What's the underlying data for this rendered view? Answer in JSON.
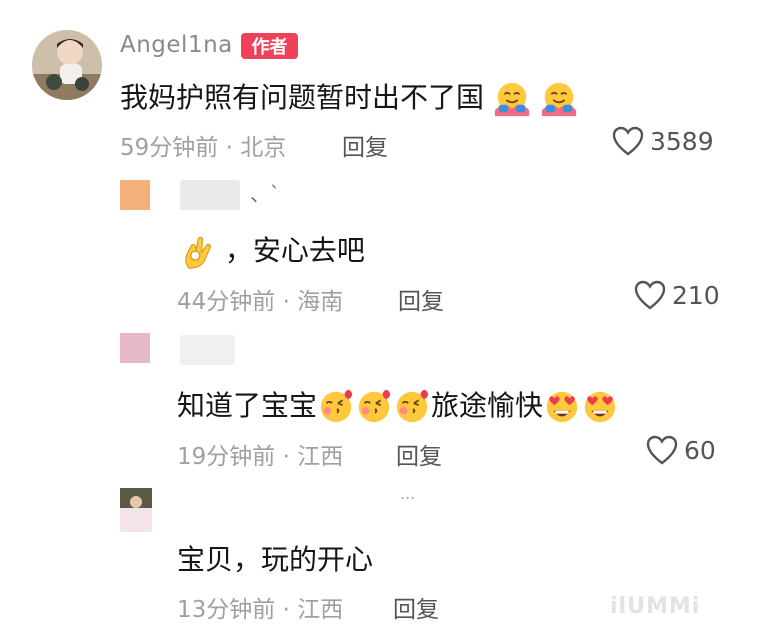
{
  "main_comment": {
    "username": "Angel1na",
    "badge": "作者",
    "text": "我妈护照有问题暂时出不了国",
    "time": "59分钟前",
    "location": "北京",
    "reply_label": "回复",
    "likes": "3589"
  },
  "replies": [
    {
      "username": "、`",
      "text": "，安心去吧",
      "time": "44分钟前",
      "location": "海南",
      "reply_label": "回复",
      "likes": "210"
    },
    {
      "text_before": "知道了宝宝",
      "text_after": "旅途愉快",
      "time": "19分钟前",
      "location": "江西",
      "reply_label": "回复",
      "likes": "60"
    },
    {
      "username": "...",
      "text": "宝贝，玩的开心",
      "time": "13分钟前",
      "location": "江西",
      "reply_label": "回复"
    }
  ],
  "separator": "·",
  "watermark": "ilUMMi",
  "colors": {
    "badge": "#f0415a",
    "meta": "#a0a0a0",
    "username": "#8a8a8a",
    "text": "#161616"
  }
}
